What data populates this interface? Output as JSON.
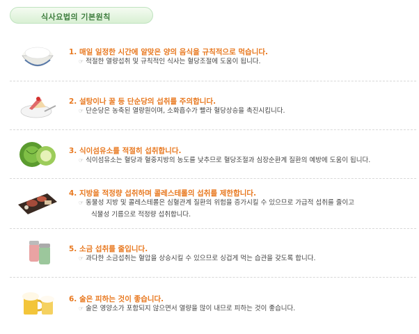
{
  "title": "식사요법의 기본원칙",
  "items": [
    {
      "heading": "1. 매일 일정한 시간에 알맞은 양의 음식을 규칙적으로 먹습니다.",
      "desc": "적절한 열량섭취 및 규칙적인 식사는 혈당조절에 도움이 됩니다.",
      "icon": "rice-bowl-icon"
    },
    {
      "heading": "2. 설탕이나 꿀 등 단순당의 섭취를 주의합니다.",
      "desc": "단순당은 농축된 열량원이며, 소화흡수가 빨라 혈당상승을 촉진시킵니다.",
      "icon": "cake-icon"
    },
    {
      "heading": "3. 식이섬유소를 적절히 섭취합니다.",
      "desc": "식이섬유소는 혈당과 혈중지방의 농도를 낮추므로 혈당조절과 심장순환계 질환의 예방에 도움이 됩니다.",
      "icon": "cabbage-icon"
    },
    {
      "heading": "4. 지방을 적정량 섭취하며 콜레스테롤의 섭취를 제한합니다.",
      "desc": "동물성 지방 및 콜레스테롤은 심혈관계 질환의 위험을 증가시킬 수 있으므로 가급적 섭취를 줄이고",
      "desc2": "식물성 기름으로 적정량 섭취합니다.",
      "icon": "meat-grill-icon"
    },
    {
      "heading": "5. 소금 섭취를 줄입니다.",
      "desc": "과다한 소금섭취는 혈압을 상승시킬 수 있으므로 싱겁게 먹는 습관을 갖도록 합니다.",
      "icon": "salt-shaker-icon"
    },
    {
      "heading": "6. 술은 피하는 것이 좋습니다.",
      "desc": "술은 영양소가 포함되지 않으면서 열량을 많이 내므로 피하는 것이 좋습니다.",
      "icon": "beer-mug-icon"
    }
  ]
}
